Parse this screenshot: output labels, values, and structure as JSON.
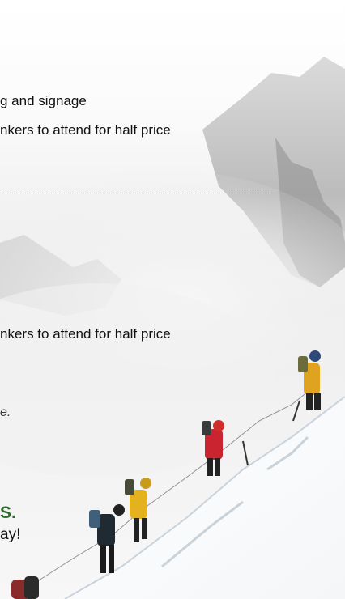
{
  "content": {
    "line1": "g and signage",
    "line2": "nkers to attend for half price",
    "line3": "nkers to attend for half price",
    "line4": "e.",
    "line5": "S.",
    "line6": "ay!"
  },
  "colors": {
    "heading_green": "#2f6b2f",
    "text": "#111111",
    "divider": "#a8a8a8"
  },
  "image": {
    "alt_semantic": "mountaineers-climbing-snowy-ridge"
  }
}
